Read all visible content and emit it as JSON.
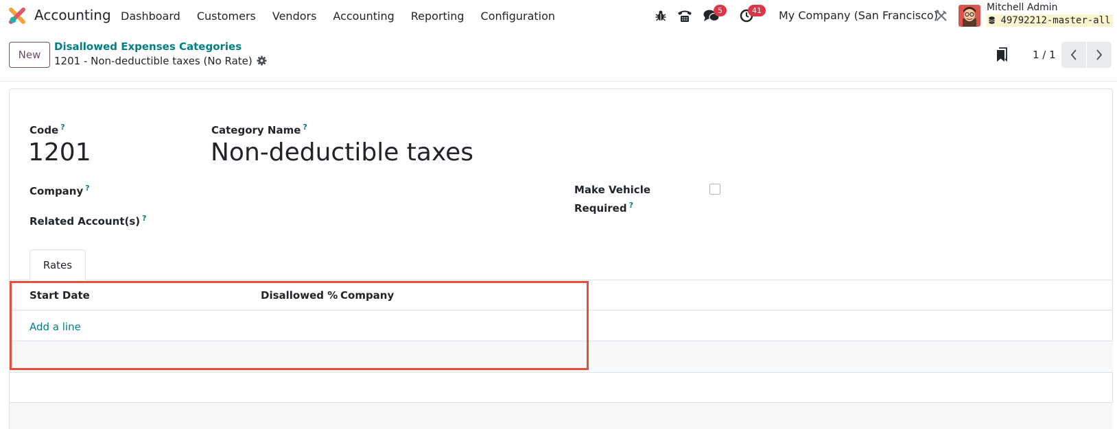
{
  "navbar": {
    "app_name": "Accounting",
    "menu": [
      "Dashboard",
      "Customers",
      "Vendors",
      "Accounting",
      "Reporting",
      "Configuration"
    ],
    "messages_count": "5",
    "activities_count": "41",
    "company": "My Company (San Francisco)",
    "user_name": "Mitchell Admin",
    "database": "49792212-master-all"
  },
  "control_panel": {
    "new_label": "New",
    "breadcrumb_parent": "Disallowed Expenses Categories",
    "breadcrumb_current": "1201 - Non-deductible taxes (No Rate)",
    "pager": "1 / 1"
  },
  "form": {
    "code_label": "Code",
    "code_value": "1201",
    "category_label": "Category Name",
    "category_value": "Non-deductible taxes",
    "company_label": "Company",
    "related_accounts_label": "Related Account(s)",
    "vehicle_label_line1": "Make Vehicle",
    "vehicle_label_line2": "Required",
    "help_mark": "?"
  },
  "tabs": [
    "Rates"
  ],
  "rates_table": {
    "columns": [
      "Start Date",
      "Disallowed %",
      "Company"
    ],
    "add_line": "Add a line"
  },
  "colors": {
    "brand": "#714b67",
    "link": "#017e84",
    "badge": "#dc3545",
    "highlight": "#e84c3d"
  }
}
